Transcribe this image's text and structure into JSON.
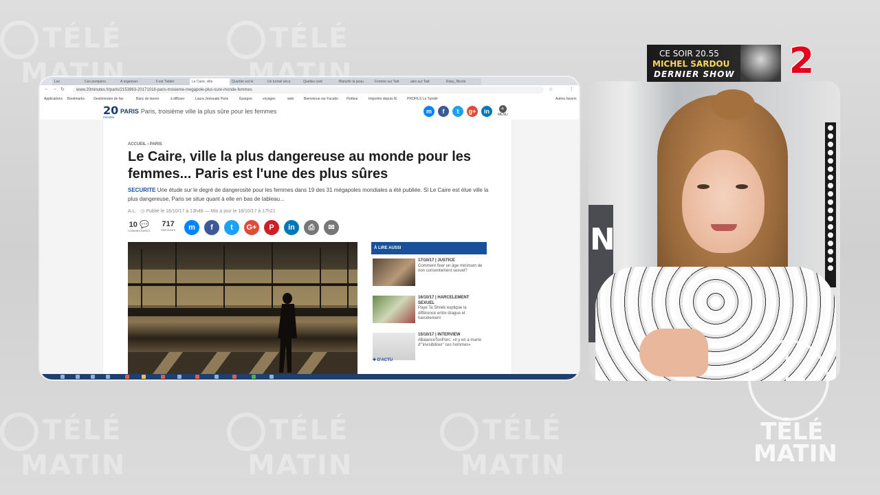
{
  "background": {
    "watermark_top": "TÉLÉ",
    "watermark_bottom": "MATIN",
    "color": "#d6d6d6"
  },
  "browser": {
    "tabs": [
      "Les",
      "Ces pompiers",
      "A organiser",
      "Il est Twitter",
      "Le Caire, ville",
      "Quartier est le",
      "Un tunnel sécu",
      "Quelles sont",
      "Blanchir la peau",
      "Femme sur Twit",
      "alex sur Twit",
      "Ruby_Nicole"
    ],
    "active_tab_index": 4,
    "url": "www.20minutes.fr/paris/2153963-20171018-paris-troisieme-megapole-plus-sure-monde-femmes",
    "bookmarks": [
      "Applications",
      "Bookmarks",
      "Gestionnaire de fav",
      "Banc de lavoro",
      "à diffuser",
      "Laura Jewouabi Paris",
      "Épargne",
      "voyages",
      "web",
      "Bienvenue sur Facebo",
      "Flotteur",
      "Importés depuis IE",
      "PROFILS Le Tumblr",
      "Autres favoris"
    ],
    "site": {
      "logo": "20",
      "logo_sub": "minutes",
      "section": "PARIS",
      "section_title": "Paris, troisième ville la plus sûre pour les femmes",
      "menu_label": "MENU",
      "share_icons": [
        "messenger-icon",
        "facebook-icon",
        "twitter-icon",
        "google-plus-icon",
        "linkedin-icon"
      ]
    },
    "article": {
      "breadcrumb": "ACCUEIL › PARIS",
      "headline": "Le Caire, ville la plus dangereuse au monde pour les femmes... Paris est l'une des plus sûres",
      "lede_tag": "SECURITE",
      "lede": "Une étude sur le degré de dangerosité pour les femmes dans 19 des 31 mégapoles mondiales a été publiée. Si Le Caire est élue ville la plus dangereuse, Paris se situe quant à elle en bas de tableau...",
      "author": "A.L.",
      "published": "Publié le 18/10/17 à 13h48 — Mis à jour le 18/10/17 à 17h21",
      "comments_count": "10",
      "comments_label": "COMMENTAIRES",
      "shares_count": "717",
      "shares_label": "PARTAGES",
      "share_buttons": [
        "messenger-icon",
        "facebook-icon",
        "twitter-icon",
        "google-plus-icon",
        "pinterest-icon",
        "linkedin-icon",
        "print-icon",
        "mail-icon"
      ]
    },
    "aside": {
      "title": "À LIRE AUSSI",
      "items": [
        {
          "date_cat": "17/10/17 | JUSTICE",
          "text": "Comment fixer un âge minimum de non consentement sexuel?"
        },
        {
          "date_cat": "16/10/17 | HARCELEMENT SEXUEL",
          "text": "Paye Ta Shnek explique la différence entre drague et harcèlement"
        },
        {
          "date_cat": "15/10/17 | INTERVIEW",
          "text": "#BalanceTonPorc: «Il y en a marre d'\"invisibiliser\" ces hommes»"
        }
      ],
      "more_label": "D'ACTU"
    }
  },
  "promo": {
    "time": "CE SOIR 20.55",
    "name": "MICHEL SARDOU",
    "show": "DERNIER SHOW",
    "channel": "2",
    "channel_color": "#e2001a"
  },
  "clock_logo": {
    "line1": "TÉLÉ",
    "line2": "MATIN"
  }
}
